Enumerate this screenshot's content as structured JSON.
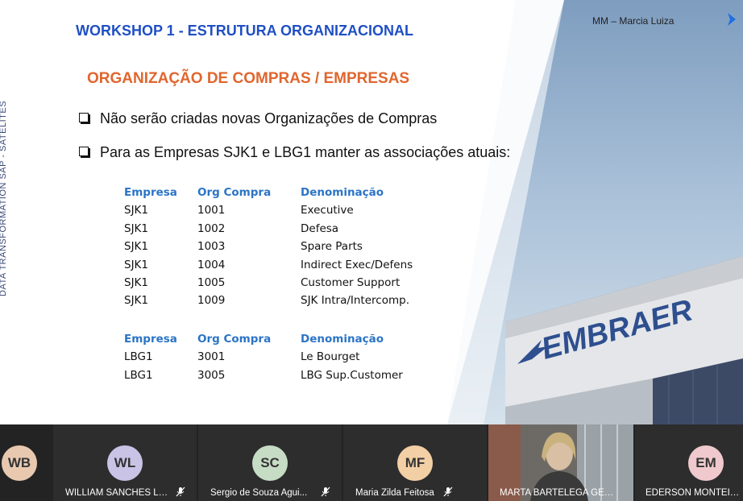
{
  "slide": {
    "side_label": "DATA  TRANSFORMATION  SAP  -  SATÉLITES",
    "workshop_title": "WORKSHOP 1  -  ESTRUTURA ORGANIZACIONAL",
    "presenter": "MM – Marcia Luiza",
    "section_title": "ORGANIZAÇÃO DE COMPRAS / EMPRESAS",
    "bullets": [
      "Não serão criadas novas Organizações de Compras",
      "Para as Empresas SJK1 e LBG1 manter as associações atuais:"
    ],
    "table1": {
      "headers": [
        "Empresa",
        "Org Compra",
        "Denominação"
      ],
      "rows": [
        [
          "SJK1",
          "1001",
          "Executive"
        ],
        [
          "SJK1",
          "1002",
          "Defesa"
        ],
        [
          "SJK1",
          "1003",
          "Spare Parts"
        ],
        [
          "SJK1",
          "1004",
          "Indirect Exec/Defens"
        ],
        [
          "SJK1",
          "1005",
          "Customer Support"
        ],
        [
          "SJK1",
          "1009",
          "SJK Intra/Intercomp."
        ]
      ]
    },
    "table2": {
      "headers": [
        "Empresa",
        "Org Compra",
        "Denominação"
      ],
      "rows": [
        [
          "LBG1",
          "3001",
          "Le Bourget"
        ],
        [
          "LBG1",
          "3005",
          "LBG Sup.Customer"
        ]
      ]
    },
    "building_sign": "EMBRAER"
  },
  "participants": [
    {
      "initials": "WB",
      "name": "",
      "color": "#e8c9b0"
    },
    {
      "initials": "WL",
      "name": "WILLIAM SANCHES LI...",
      "color": "#c9c3e6",
      "muted": true
    },
    {
      "initials": "SC",
      "name": "Sergio de Souza Agui...",
      "color": "#c6dcc5",
      "muted": true
    },
    {
      "initials": "MF",
      "name": "Maria Zilda Feitosa",
      "color": "#f3cfa6",
      "muted": true
    },
    {
      "initials": "",
      "name": "MARTA BARTELEGA GEMB...",
      "color": "#8a7d6f",
      "video": true
    },
    {
      "initials": "EM",
      "name": "EDERSON MONTEIRO",
      "color": "#efc9cd"
    }
  ],
  "colors": {
    "title_blue": "#1f4fc4",
    "section_orange": "#e0662e",
    "table_header": "#2b74c6"
  }
}
